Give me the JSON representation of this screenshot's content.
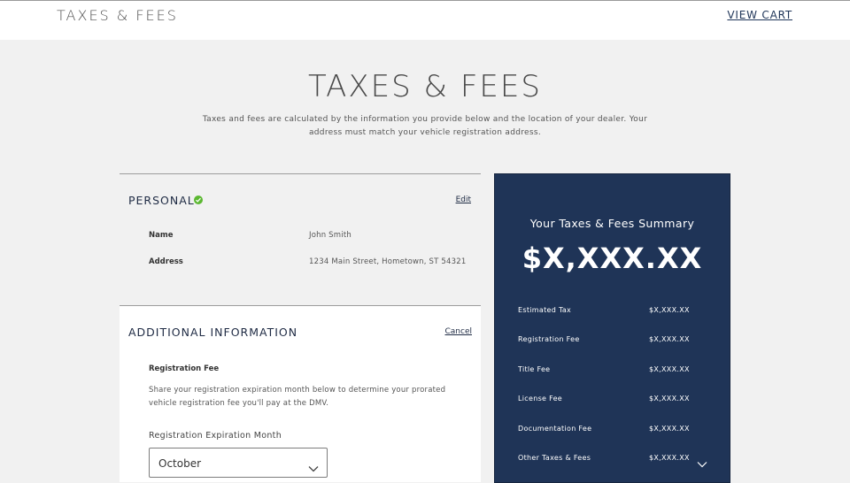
{
  "header": {
    "title": "TAXES & FEES",
    "cart_link": "VIEW CART"
  },
  "page": {
    "title": "TAXES & FEES",
    "subtitle": "Taxes and fees are calculated by the information you provide below and the location of your dealer. Your address must match your vehicle registration address."
  },
  "personal": {
    "heading": "PERSONAL",
    "edit_label": "Edit",
    "status_icon": "check-circle-icon",
    "status_color": "#5cb832",
    "fields": [
      {
        "label": "Name",
        "value": "John Smith"
      },
      {
        "label": "Address",
        "value": "1234 Main Street, Hometown, ST 54321"
      }
    ]
  },
  "additional": {
    "heading": "ADDITIONAL INFORMATION",
    "cancel_label": "Cancel",
    "reg_fee_heading": "Registration Fee",
    "reg_fee_description": "Share your registration expiration month below to determine your prorated vehicle registration fee you'll pay at the DMV.",
    "month_label": "Registration Expiration Month",
    "month_selected": "October"
  },
  "summary": {
    "title": "Your Taxes & Fees Summary",
    "total": "$X,XXX.XX",
    "background_color": "#1f3457",
    "rows": [
      {
        "label": "Estimated Tax",
        "value": "$X,XXX.XX"
      },
      {
        "label": "Registration Fee",
        "value": "$X,XXX.XX"
      },
      {
        "label": "Title Fee",
        "value": "$X,XXX.XX"
      },
      {
        "label": "License Fee",
        "value": "$X,XXX.XX"
      },
      {
        "label": "Documentation Fee",
        "value": "$X,XXX.XX"
      },
      {
        "label": "Other Taxes & Fees",
        "value": "$X,XXX.XX"
      }
    ]
  }
}
